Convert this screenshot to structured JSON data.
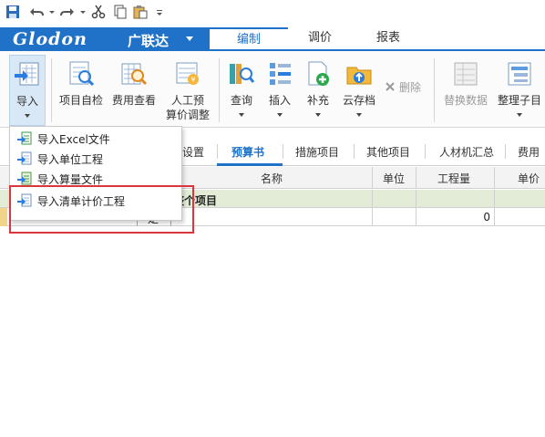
{
  "quick_access": {
    "icons": [
      "save-icon",
      "undo-icon",
      "redo-icon",
      "cut-icon",
      "copy-icon",
      "paste-icon",
      "customize-icon"
    ]
  },
  "brand": {
    "logo": "Glodon",
    "name_cn": "广联达",
    "color": "#1f72c7"
  },
  "main_tabs": [
    {
      "label": "编制",
      "active": true
    },
    {
      "label": "调价",
      "active": false
    },
    {
      "label": "报表",
      "active": false
    }
  ],
  "ribbon": {
    "import": "导入",
    "self_check": "项目自检",
    "fee_view": "费用查看",
    "manual_adjust_1": "人工预",
    "manual_adjust_2": "算价调整",
    "query": "查询",
    "insert": "插入",
    "supplement": "补充",
    "cloud_archive": "云存档",
    "delete": "删除",
    "replace_data": "替换数据",
    "organize_sub": "整理子目"
  },
  "import_menu": {
    "items": [
      {
        "label": "导入Excel文件"
      },
      {
        "label": "导入单位工程"
      },
      {
        "label": "导入算量文件"
      },
      {
        "label": "导入清单计价工程"
      }
    ],
    "highlight_color": "#d9363e"
  },
  "sub_tabs": {
    "settings": "设置",
    "budget": "预算书",
    "measures": "措施项目",
    "others": "其他项目",
    "labor_summary": "人材机汇总",
    "fees": "费用"
  },
  "table": {
    "headers": {
      "name": "名称",
      "unit": "单位",
      "quantity": "工程量",
      "unit_price": "单价"
    },
    "row1": {
      "name": "整个项目"
    },
    "row2": {
      "code_suffix": "定",
      "quantity": "0"
    }
  }
}
